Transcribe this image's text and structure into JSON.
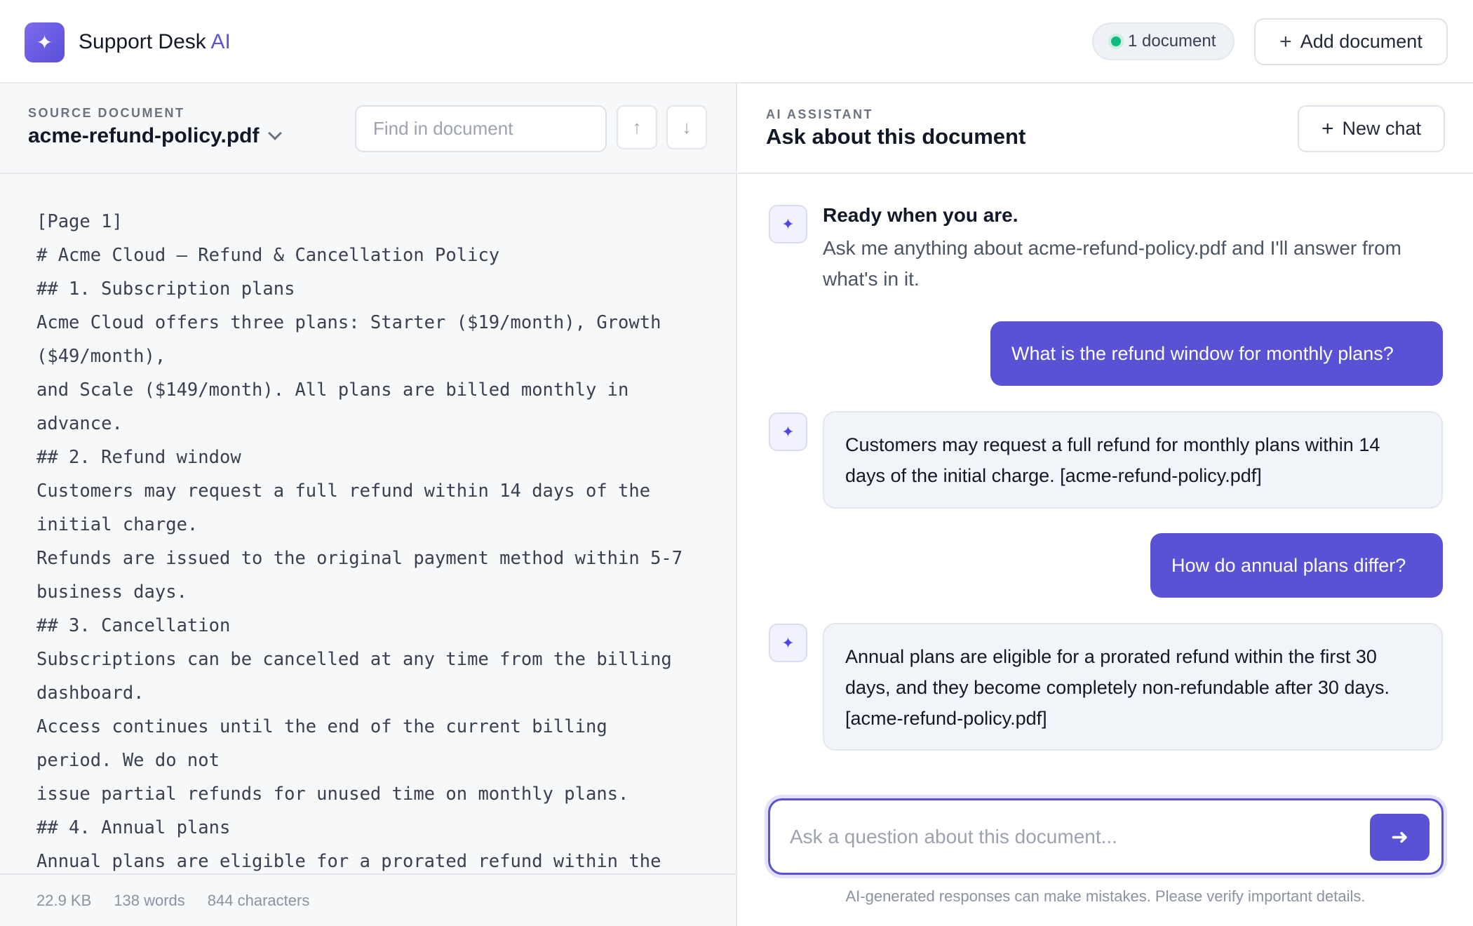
{
  "app": {
    "brand_name": "Support Desk",
    "brand_accent": "AI",
    "docs_count_label": "1 document",
    "add_document_label": "Add document"
  },
  "source": {
    "eyebrow": "SOURCE DOCUMENT",
    "file_name": "acme-refund-policy.pdf",
    "find_placeholder": "Find in document",
    "lines": [
      "[Page 1]",
      "# Acme Cloud — Refund & Cancellation Policy",
      "## 1. Subscription plans",
      "Acme Cloud offers three plans: Starter ($19/month), Growth",
      "($49/month),",
      "and Scale ($149/month). All plans are billed monthly in",
      "advance.",
      "## 2. Refund window",
      "Customers may request a full refund within 14 days of the",
      "initial charge.",
      "Refunds are issued to the original payment method within 5-7",
      "business days.",
      "## 3. Cancellation",
      "Subscriptions can be cancelled at any time from the billing",
      "dashboard.",
      "Access continues until the end of the current billing",
      "period. We do not",
      "issue partial refunds for unused time on monthly plans.",
      "## 4. Annual plans",
      "Annual plans are eligible for a prorated refund within the"
    ],
    "stats": {
      "size": "22.9 KB",
      "words": "138 words",
      "characters": "844 characters"
    }
  },
  "assistant": {
    "eyebrow": "AI ASSISTANT",
    "title": "Ask about this document",
    "new_chat_label": "New chat",
    "welcome_title": "Ready when you are.",
    "welcome_text": "Ask me anything about acme-refund-policy.pdf and I'll answer from what's in it.",
    "messages": [
      {
        "role": "user",
        "text": "What is the refund window for monthly plans?"
      },
      {
        "role": "assistant",
        "text": "Customers may request a full refund for monthly plans within 14 days of the initial charge. [acme-refund-policy.pdf]"
      },
      {
        "role": "user",
        "text": "How do annual plans differ?"
      },
      {
        "role": "assistant",
        "text": "Annual plans are eligible for a prorated refund within the first 30 days, and they become completely non-refundable after 30 days. [acme-refund-policy.pdf]"
      }
    ],
    "composer_placeholder": "Ask a question about this document...",
    "disclaimer": "AI-generated responses can make mistakes. Please verify important details."
  },
  "icons": {
    "logo": "sparkle-icon",
    "status_dot": "green-dot-icon",
    "accent_color": "#5a52d5",
    "status_color": "#10b981"
  }
}
